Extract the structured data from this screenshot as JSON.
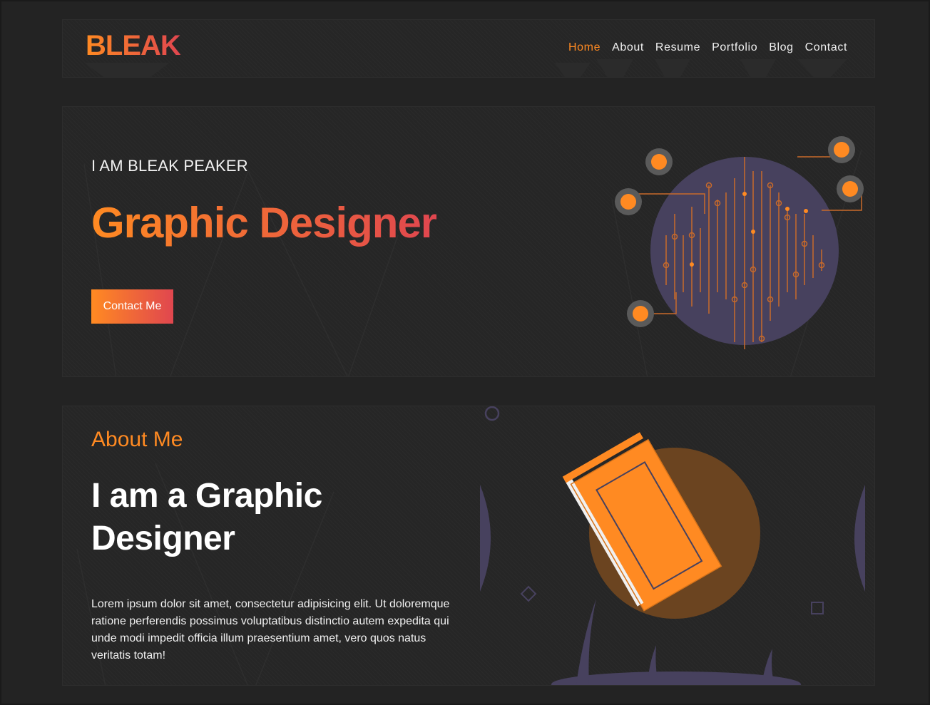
{
  "header": {
    "logo": "BLEAK",
    "nav": [
      "Home",
      "About",
      "Resume",
      "Portfolio",
      "Blog",
      "Contact"
    ],
    "active_nav": "Home"
  },
  "hero": {
    "intro": "I AM BLEAK PEAKER",
    "title": "Graphic Designer",
    "button_label": "Contact Me"
  },
  "about": {
    "label": "About Me",
    "title": "I am a Graphic Designer",
    "body": "Lorem ipsum dolor sit amet, consectetur adipisicing elit. Ut doloremque ratione perferendis possimus voluptatibus distinctio autem expedita qui unde modi impedit officia illum praesentium amet, vero quos natus veritatis totam!"
  },
  "colors": {
    "accent_orange": "#ff8a22",
    "accent_red": "#e0464f",
    "background": "#232323",
    "panel": "#262626",
    "illustration_purple": "#47415e"
  },
  "icons": [
    "circuit-globe-illustration",
    "book-illustration"
  ]
}
